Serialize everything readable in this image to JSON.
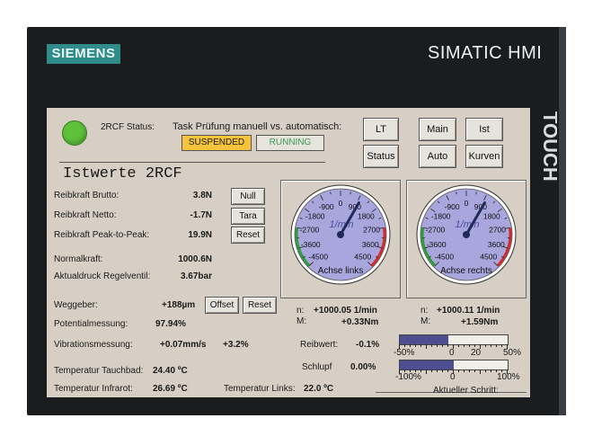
{
  "header": {
    "brand": "SIEMENS",
    "title": "SIMATIC HMI",
    "touch": "TOUCH"
  },
  "status": {
    "label": "2RCF Status:",
    "task_label": "Task Prüfung manuell vs. automatisch:",
    "suspended": "SUSPENDED",
    "running": "RUNNING",
    "led_color": "#5ec13a",
    "suspended_color": "#f5c43a",
    "running_color": "#3d9a52"
  },
  "nav": {
    "lt": "LT",
    "main": "Main",
    "ist": "Ist",
    "status": "Status",
    "auto": "Auto",
    "kurven": "Kurven"
  },
  "section_title": "Istwerte 2RCF",
  "values": {
    "reibkraft_brutto_label": "Reibkraft Brutto:",
    "reibkraft_brutto": "3.8N",
    "null_btn": "Null",
    "reibkraft_netto_label": "Reibkraft Netto:",
    "reibkraft_netto": "-1.7N",
    "tara_btn": "Tara",
    "peak_label": "Reibkraft Peak-to-Peak:",
    "peak": "19.9N",
    "reset_btn": "Reset",
    "normalkraft_label": "Normalkraft:",
    "normalkraft": "1000.6N",
    "aktualdruck_label": "Aktualdruck Regelventil:",
    "aktualdruck": "3.67bar",
    "weggeber_label": "Weggeber:",
    "weggeber": "+188µm",
    "offset_btn": "Offset",
    "reset2_btn": "Reset",
    "potential_label": "Potentialmessung:",
    "potential": "97.94%",
    "vibration_label": "Vibrationsmessung:",
    "vibration": "+0.07mm/s",
    "vibration_pct": "+3.2%",
    "temp_tauch_label": "Temperatur Tauchbad:",
    "temp_tauch": "24.40 ºC",
    "temp_infra_label": "Temperatur Infrarot:",
    "temp_infra": "26.69 ºC",
    "temp_links_label": "Temperatur Links:",
    "temp_links": "22.0 ºC"
  },
  "gauges": {
    "unit": "1/min",
    "ticks": [
      "-4500",
      "-3600",
      "-2700",
      "-1800",
      "-900",
      "0",
      "900",
      "1800",
      "2700",
      "3600",
      "4500"
    ],
    "left": {
      "label": "Achse links",
      "value": 1000.05,
      "n_label": "n:",
      "n": "+1000.05 1/min",
      "m_label": "M:",
      "m": "+0.33Nm"
    },
    "right": {
      "label": "Achse rechts",
      "value": 1000.11,
      "n_label": "n:",
      "n": "+1000.11 1/min",
      "m_label": "M:",
      "m": "+1.59Nm"
    }
  },
  "reibwert": {
    "label": "Reibwert:",
    "value": "-0.1%",
    "fill": 0.45,
    "scale": [
      "-50%",
      "0",
      "20",
      "50%"
    ]
  },
  "schlupf": {
    "label": "Schlupf",
    "value": "0.00%",
    "fill": 0.5,
    "scale": [
      "-100%",
      "0",
      "100%"
    ]
  },
  "schritt_label": "Aktueller Schritt:"
}
